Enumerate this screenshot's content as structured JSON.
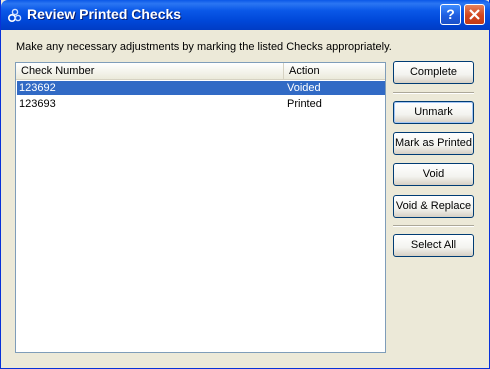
{
  "window": {
    "title": "Review Printed Checks",
    "help_glyph": "?",
    "icons": {
      "app": "three-gears-icon",
      "help": "help-icon",
      "close": "close-icon"
    },
    "colors": {
      "titlebar": "#0A58E8",
      "face": "#ECE9D8",
      "selection": "#316AC5"
    }
  },
  "instructions": "Make any necessary adjustments by marking the listed Checks appropriately.",
  "list": {
    "columns": [
      "Check Number",
      "Action"
    ],
    "rows": [
      {
        "check_number": "123692",
        "action": "Voided",
        "selected": true
      },
      {
        "check_number": "123693",
        "action": "Printed",
        "selected": false
      }
    ]
  },
  "buttons": {
    "complete": "Complete",
    "unmark": "Unmark",
    "mark_as_printed": "Mark as Printed",
    "void": "Void",
    "void_replace": "Void & Replace",
    "select_all": "Select All"
  }
}
